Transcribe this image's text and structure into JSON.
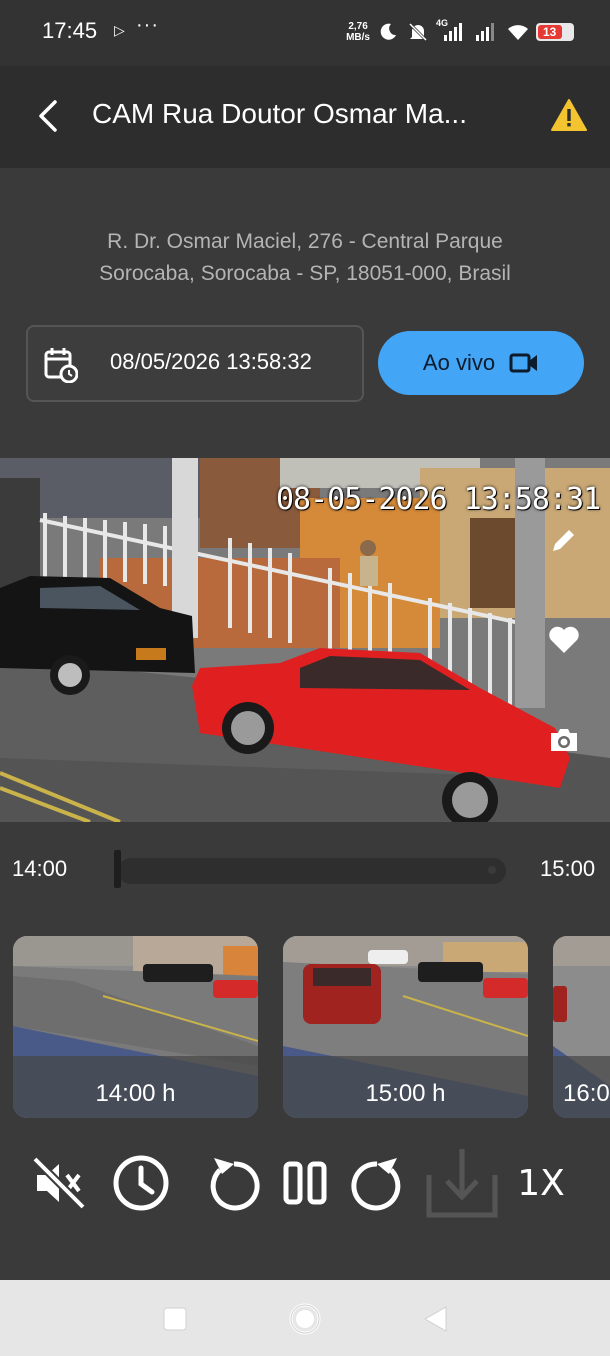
{
  "status_bar": {
    "time": "17:45",
    "play_glyph": "▷",
    "more_glyph": "···",
    "speed_value": "2,76",
    "speed_unit": "MB/s",
    "network": "4G",
    "battery": "13",
    "icons": [
      "moon-icon",
      "mute-notifications-icon",
      "signal-icon",
      "wifi-icon",
      "battery-icon"
    ]
  },
  "header": {
    "title": "CAM Rua Doutor Osmar Ma...",
    "back_icon": "chevron-left-icon",
    "warning_icon": "warning-icon",
    "accent": "#f4c430"
  },
  "address": {
    "line1": "R. Dr. Osmar Maciel, 276 - Central Parque",
    "line2": "Sorocaba, Sorocaba - SP, 18051-000, Brasil"
  },
  "date_picker": {
    "value": "08/05/2026 13:58:32",
    "icon": "calendar-clock-icon"
  },
  "live_button": {
    "label": "Ao vivo",
    "icon": "video-camera-icon",
    "color": "#42a5f5"
  },
  "video": {
    "timestamp": "08-05-2026 13:58:31",
    "side_icons": [
      "edit-icon",
      "heart-icon",
      "camera-icon"
    ]
  },
  "timeline": {
    "start": "14:00",
    "end": "15:00"
  },
  "thumbnails": [
    {
      "label": "14:00 h"
    },
    {
      "label": "15:00 h"
    },
    {
      "label": "16:0"
    }
  ],
  "controls": {
    "icons": [
      "volume-off-icon",
      "clock-icon",
      "rewind-icon",
      "pause-icon",
      "forward-icon",
      "download-icon"
    ],
    "speed": "1X"
  },
  "nav_bar": {
    "icons": [
      "recent-apps-icon",
      "home-icon",
      "back-icon"
    ]
  }
}
